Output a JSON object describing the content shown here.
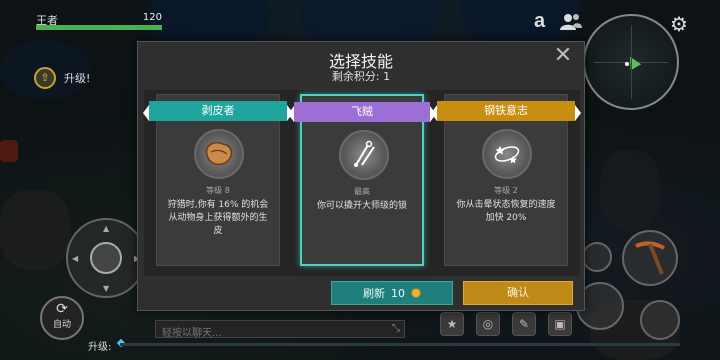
{
  "hud": {
    "player_name": "王者",
    "hp_value": "120",
    "level_up_top": "升级!",
    "level_up_bottom": "升级:",
    "auto_label": "自动",
    "chat_placeholder": "轻按以聊天...",
    "hp_fill": 1.0
  },
  "modal": {
    "title": "选择技能",
    "points_label": "剩余积分: 1",
    "close_label": "✕",
    "refresh_label": "刷新",
    "refresh_cost": "10",
    "confirm_label": "确认"
  },
  "cards": [
    {
      "name": "剥皮者",
      "ribbon_color": "#1fa59c",
      "level": "等级 8",
      "description": "狩猎时,你有 16% 的机会从动物身上获得额外的生皮",
      "icon": "hide-icon"
    },
    {
      "name": "飞贼",
      "ribbon_color": "#9b6fd6",
      "level": "最高",
      "description": "你可以撬开大师级的锁",
      "icon": "lockpick-icon"
    },
    {
      "name": "钢铁意志",
      "ribbon_color": "#c98d12",
      "level": "等级 2",
      "description": "你从击晕状态恢复的速度加快 20%",
      "icon": "stun-icon"
    }
  ],
  "colors": {
    "accent_teal": "#1f7f7a",
    "confirm_gold": "#bf8a18",
    "hp_green": "#4caf50"
  }
}
